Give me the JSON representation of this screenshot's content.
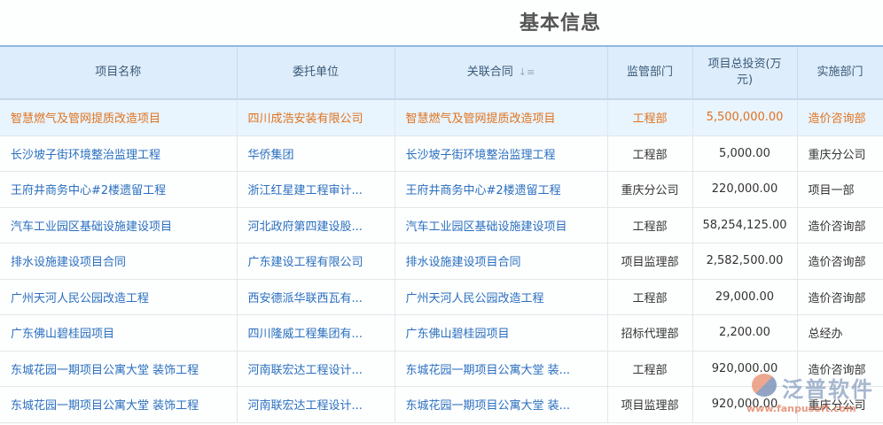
{
  "title": "基本信息",
  "columns": [
    "项目名称",
    "委托单位",
    "关联合同",
    "监管部门",
    "项目总投资(万元)",
    "实施部门"
  ],
  "rows": [
    {
      "name": "智慧燃气及管网提质改造项目",
      "client": "四川成浩安装有限公司",
      "contract": "智慧燃气及管网提质改造项目",
      "supervisor": "工程部",
      "investment": "5,500,000.00",
      "dept": "造价咨询部"
    },
    {
      "name": "长沙坡子街环境整治监理工程",
      "client": "华侨集团",
      "contract": "长沙坡子街环境整治监理工程",
      "supervisor": "工程部",
      "investment": "5,000.00",
      "dept": "重庆分公司"
    },
    {
      "name": "王府井商务中心#2楼遗留工程",
      "client": "浙江红星建工程审计...",
      "contract": "王府井商务中心#2楼遗留工程",
      "supervisor": "重庆分公司",
      "investment": "220,000.00",
      "dept": "项目一部"
    },
    {
      "name": "汽车工业园区基础设施建设项目",
      "client": "河北政府第四建设股...",
      "contract": "汽车工业园区基础设施建设项目",
      "supervisor": "工程部",
      "investment": "58,254,125.00",
      "dept": "造价咨询部"
    },
    {
      "name": "排水设施建设项目合同",
      "client": "广东建设工程有限公司",
      "contract": "排水设施建设项目合同",
      "supervisor": "项目监理部",
      "investment": "2,582,500.00",
      "dept": "造价咨询部"
    },
    {
      "name": "广州天河人民公园改造工程",
      "client": "西安德派华联西瓦有...",
      "contract": "广州天河人民公园改造工程",
      "supervisor": "工程部",
      "investment": "29,000.00",
      "dept": "造价咨询部"
    },
    {
      "name": "广东佛山碧桂园项目",
      "client": "四川隆威工程集团有...",
      "contract": "广东佛山碧桂园项目",
      "supervisor": "招标代理部",
      "investment": "2,200.00",
      "dept": "总经办"
    },
    {
      "name": "东城花园一期项目公寓大堂 装饰工程",
      "client": "河南联宏达工程设计...",
      "contract": "东城花园一期项目公寓大堂 装...",
      "supervisor": "工程部",
      "investment": "920,000.00",
      "dept": "造价咨询部"
    },
    {
      "name": "东城花园一期项目公寓大堂 装饰工程",
      "client": "河南联宏达工程设计...",
      "contract": "东城花园一期项目公寓大堂 装...",
      "supervisor": "项目监理部",
      "investment": "920,000.00",
      "dept": "重庆分公司"
    }
  ],
  "watermark": {
    "name": "泛普软件",
    "url": "www.fanpusoft.com"
  }
}
